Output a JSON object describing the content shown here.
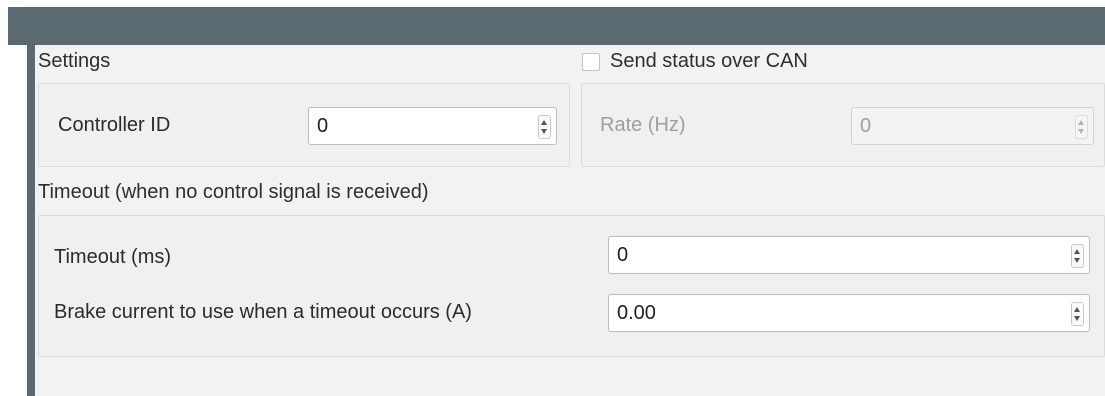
{
  "settings": {
    "title": "Settings",
    "controller_id_label": "Controller ID",
    "controller_id_value": "0"
  },
  "can_status": {
    "checkbox_label": "Send status over CAN",
    "checked": false,
    "rate_label": "Rate (Hz)",
    "rate_value": "0"
  },
  "timeout": {
    "title": "Timeout (when no control signal is received)",
    "timeout_label": "Timeout (ms)",
    "timeout_value": "0",
    "brake_label": "Brake current to use when a timeout occurs (A)",
    "brake_value": "0.00"
  },
  "colors": {
    "header_bar": "#5b6a70",
    "panel_background": "#f2f2f2"
  }
}
